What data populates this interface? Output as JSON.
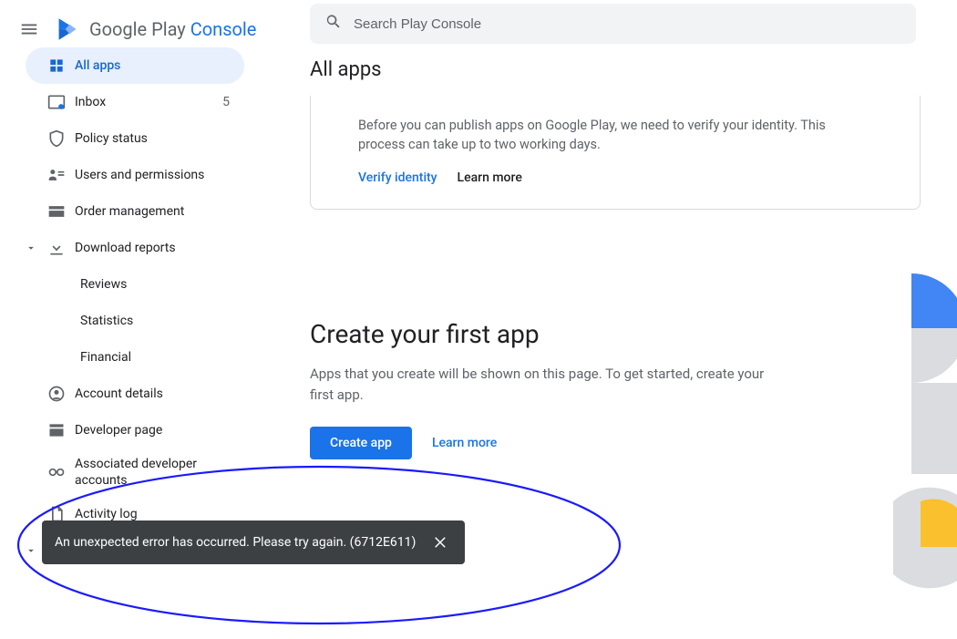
{
  "brand": {
    "title_a": "Google Play ",
    "title_b": "Console"
  },
  "search": {
    "placeholder": "Search Play Console"
  },
  "sidebar": {
    "items": [
      {
        "label": "All apps"
      },
      {
        "label": "Inbox",
        "badge": "5"
      },
      {
        "label": "Policy status"
      },
      {
        "label": "Users and permissions"
      },
      {
        "label": "Order management"
      },
      {
        "label": "Download reports"
      },
      {
        "label": "Account details"
      },
      {
        "label": "Developer page"
      },
      {
        "label": "Associated developer accounts"
      },
      {
        "label": "Activity log"
      }
    ],
    "subitems": {
      "reviews": "Reviews",
      "statistics": "Statistics",
      "financial": "Financial"
    }
  },
  "main": {
    "page_title": "All apps",
    "identity_card": {
      "body": "Before you can publish apps on Google Play, we need to verify your identity. This process can take up to two working days.",
      "verify_label": "Verify identity",
      "learn_label": "Learn more"
    },
    "empty_state": {
      "heading": "Create your first app",
      "body": "Apps that you create will be shown on this page. To get started, create your first app.",
      "create_label": "Create app",
      "learn_label": "Learn more"
    }
  },
  "toast": {
    "text": "An unexpected error has occurred. Please try again. (6712E611)"
  },
  "colors": {
    "accent": "#1a73e8",
    "deco_yellow": "#fbc02d",
    "deco_gray": "#dadce0",
    "deco_blue": "#4285f4"
  }
}
